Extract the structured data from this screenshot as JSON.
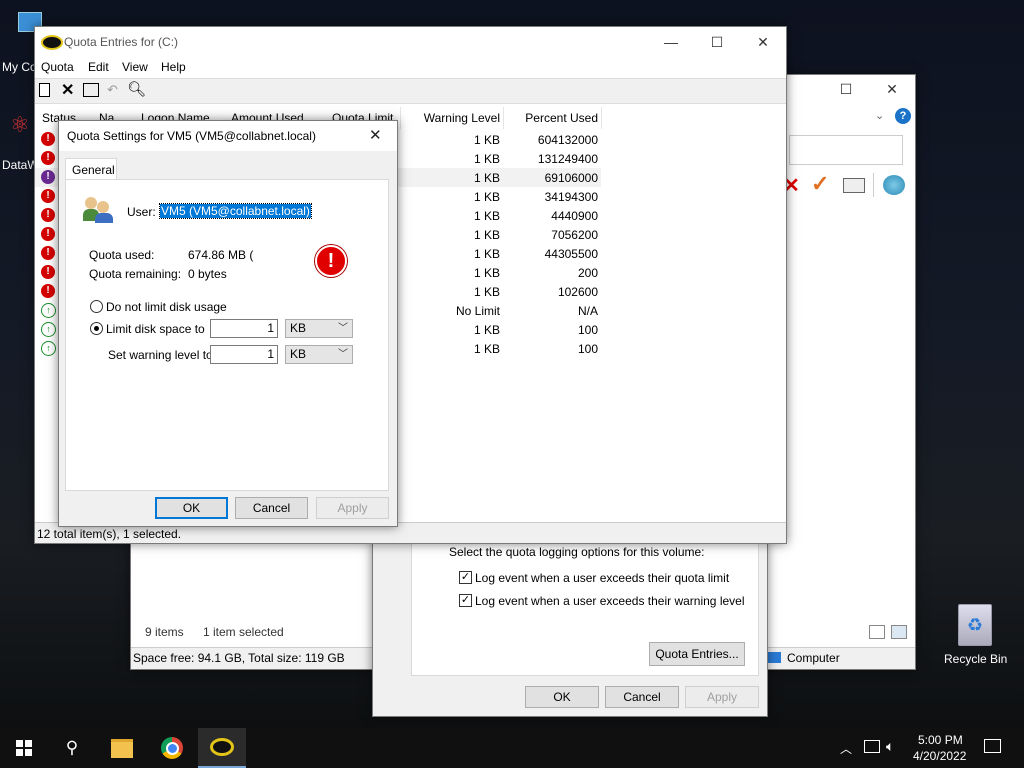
{
  "desktop": {
    "icons": [
      {
        "label": "My Co"
      },
      {
        "label": "DataW"
      },
      {
        "label": "Recycle Bin"
      }
    ]
  },
  "explorer": {
    "status_items": "9 items",
    "status_selected": "1 item selected",
    "space": "Space free: 94.1 GB, Total size: 119 GB",
    "computer": "Computer"
  },
  "properties": {
    "logging_label": "Select the quota logging options for this volume:",
    "log_quota": "Log event when a user exceeds their quota limit",
    "log_warning": "Log event when a user exceeds their warning level",
    "quota_entries_btn": "Quota Entries...",
    "ok": "OK",
    "cancel": "Cancel",
    "apply": "Apply"
  },
  "quota_window": {
    "title": "Quota Entries for  (C:)",
    "menu": [
      "Quota",
      "Edit",
      "View",
      "Help"
    ],
    "columns": [
      "Status",
      "Na...",
      "Logon Name",
      "Amount Used",
      "Quota Limit",
      "Warning Level",
      "Percent Used"
    ],
    "rows": [
      {
        "status": "error",
        "warning": "1 KB",
        "percent": "604132000"
      },
      {
        "status": "error",
        "warning": "1 KB",
        "percent": "131249400"
      },
      {
        "status": "purple",
        "warning": "1 KB",
        "percent": "69106000"
      },
      {
        "status": "error",
        "warning": "1 KB",
        "percent": "34194300"
      },
      {
        "status": "error",
        "warning": "1 KB",
        "percent": "4440900"
      },
      {
        "status": "error",
        "warning": "1 KB",
        "percent": "7056200"
      },
      {
        "status": "error",
        "warning": "1 KB",
        "percent": "44305500"
      },
      {
        "status": "error",
        "warning": "1 KB",
        "percent": "200"
      },
      {
        "status": "error",
        "warning": "1 KB",
        "percent": "102600"
      },
      {
        "status": "ok",
        "warning": "No Limit",
        "percent": "N/A"
      },
      {
        "status": "ok",
        "warning": "1 KB",
        "percent": "100"
      },
      {
        "status": "ok",
        "warning": "1 KB",
        "percent": "100"
      }
    ],
    "status_bar": "12 total item(s), 1 selected."
  },
  "dialog": {
    "title": "Quota Settings for VM5 (VM5@collabnet.local)",
    "tab": "General",
    "user_label": "User:",
    "user_value": "VM5 (VM5@collabnet.local)",
    "quota_used_label": "Quota used:",
    "quota_used_value": "674.86 MB (",
    "quota_remaining_label": "Quota remaining:",
    "quota_remaining_value": "0 bytes",
    "no_limit": "Do not limit disk usage",
    "limit": "Limit disk space to",
    "limit_value": "1",
    "limit_unit": "KB",
    "warn": "Set warning level to",
    "warn_value": "1",
    "warn_unit": "KB",
    "ok": "OK",
    "cancel": "Cancel",
    "apply": "Apply"
  },
  "taskbar": {
    "time": "5:00 PM",
    "date": "4/20/2022"
  }
}
